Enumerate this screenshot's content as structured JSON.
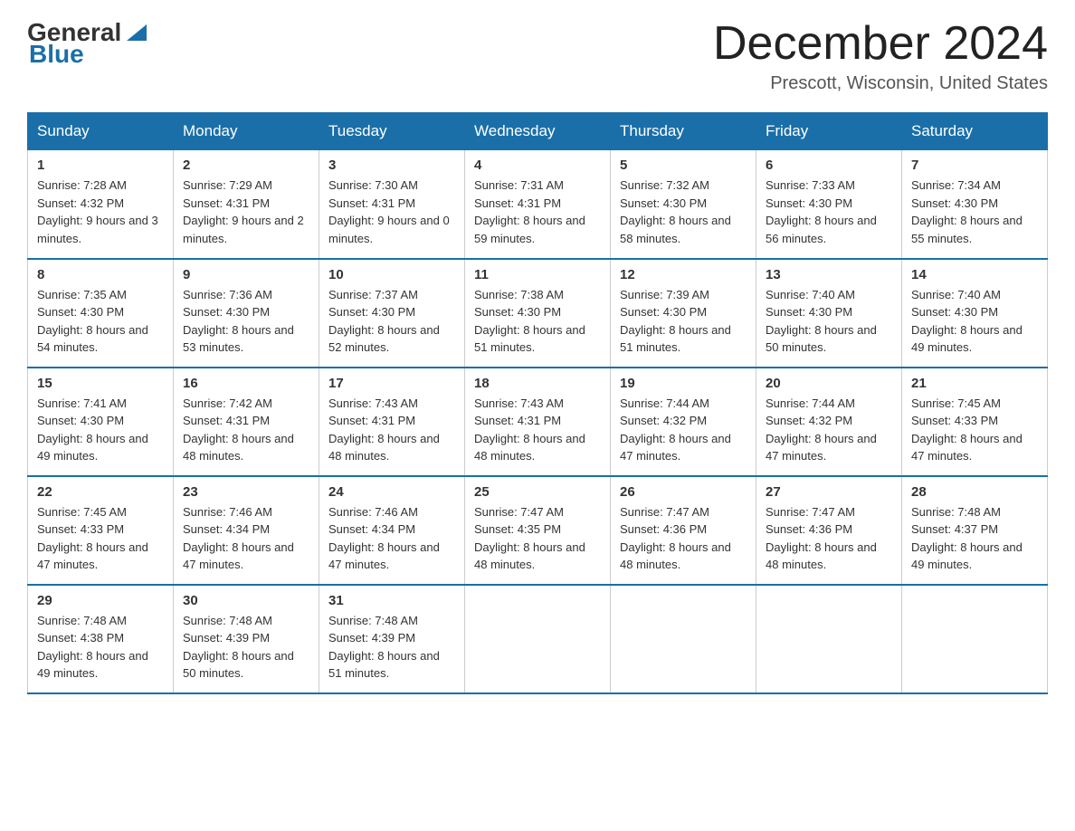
{
  "header": {
    "logo_general": "General",
    "logo_blue": "Blue",
    "month_title": "December 2024",
    "location": "Prescott, Wisconsin, United States"
  },
  "days_of_week": [
    "Sunday",
    "Monday",
    "Tuesday",
    "Wednesday",
    "Thursday",
    "Friday",
    "Saturday"
  ],
  "weeks": [
    [
      {
        "day": "1",
        "sunrise": "7:28 AM",
        "sunset": "4:32 PM",
        "daylight": "9 hours and 3 minutes."
      },
      {
        "day": "2",
        "sunrise": "7:29 AM",
        "sunset": "4:31 PM",
        "daylight": "9 hours and 2 minutes."
      },
      {
        "day": "3",
        "sunrise": "7:30 AM",
        "sunset": "4:31 PM",
        "daylight": "9 hours and 0 minutes."
      },
      {
        "day": "4",
        "sunrise": "7:31 AM",
        "sunset": "4:31 PM",
        "daylight": "8 hours and 59 minutes."
      },
      {
        "day": "5",
        "sunrise": "7:32 AM",
        "sunset": "4:30 PM",
        "daylight": "8 hours and 58 minutes."
      },
      {
        "day": "6",
        "sunrise": "7:33 AM",
        "sunset": "4:30 PM",
        "daylight": "8 hours and 56 minutes."
      },
      {
        "day": "7",
        "sunrise": "7:34 AM",
        "sunset": "4:30 PM",
        "daylight": "8 hours and 55 minutes."
      }
    ],
    [
      {
        "day": "8",
        "sunrise": "7:35 AM",
        "sunset": "4:30 PM",
        "daylight": "8 hours and 54 minutes."
      },
      {
        "day": "9",
        "sunrise": "7:36 AM",
        "sunset": "4:30 PM",
        "daylight": "8 hours and 53 minutes."
      },
      {
        "day": "10",
        "sunrise": "7:37 AM",
        "sunset": "4:30 PM",
        "daylight": "8 hours and 52 minutes."
      },
      {
        "day": "11",
        "sunrise": "7:38 AM",
        "sunset": "4:30 PM",
        "daylight": "8 hours and 51 minutes."
      },
      {
        "day": "12",
        "sunrise": "7:39 AM",
        "sunset": "4:30 PM",
        "daylight": "8 hours and 51 minutes."
      },
      {
        "day": "13",
        "sunrise": "7:40 AM",
        "sunset": "4:30 PM",
        "daylight": "8 hours and 50 minutes."
      },
      {
        "day": "14",
        "sunrise": "7:40 AM",
        "sunset": "4:30 PM",
        "daylight": "8 hours and 49 minutes."
      }
    ],
    [
      {
        "day": "15",
        "sunrise": "7:41 AM",
        "sunset": "4:30 PM",
        "daylight": "8 hours and 49 minutes."
      },
      {
        "day": "16",
        "sunrise": "7:42 AM",
        "sunset": "4:31 PM",
        "daylight": "8 hours and 48 minutes."
      },
      {
        "day": "17",
        "sunrise": "7:43 AM",
        "sunset": "4:31 PM",
        "daylight": "8 hours and 48 minutes."
      },
      {
        "day": "18",
        "sunrise": "7:43 AM",
        "sunset": "4:31 PM",
        "daylight": "8 hours and 48 minutes."
      },
      {
        "day": "19",
        "sunrise": "7:44 AM",
        "sunset": "4:32 PM",
        "daylight": "8 hours and 47 minutes."
      },
      {
        "day": "20",
        "sunrise": "7:44 AM",
        "sunset": "4:32 PM",
        "daylight": "8 hours and 47 minutes."
      },
      {
        "day": "21",
        "sunrise": "7:45 AM",
        "sunset": "4:33 PM",
        "daylight": "8 hours and 47 minutes."
      }
    ],
    [
      {
        "day": "22",
        "sunrise": "7:45 AM",
        "sunset": "4:33 PM",
        "daylight": "8 hours and 47 minutes."
      },
      {
        "day": "23",
        "sunrise": "7:46 AM",
        "sunset": "4:34 PM",
        "daylight": "8 hours and 47 minutes."
      },
      {
        "day": "24",
        "sunrise": "7:46 AM",
        "sunset": "4:34 PM",
        "daylight": "8 hours and 47 minutes."
      },
      {
        "day": "25",
        "sunrise": "7:47 AM",
        "sunset": "4:35 PM",
        "daylight": "8 hours and 48 minutes."
      },
      {
        "day": "26",
        "sunrise": "7:47 AM",
        "sunset": "4:36 PM",
        "daylight": "8 hours and 48 minutes."
      },
      {
        "day": "27",
        "sunrise": "7:47 AM",
        "sunset": "4:36 PM",
        "daylight": "8 hours and 48 minutes."
      },
      {
        "day": "28",
        "sunrise": "7:48 AM",
        "sunset": "4:37 PM",
        "daylight": "8 hours and 49 minutes."
      }
    ],
    [
      {
        "day": "29",
        "sunrise": "7:48 AM",
        "sunset": "4:38 PM",
        "daylight": "8 hours and 49 minutes."
      },
      {
        "day": "30",
        "sunrise": "7:48 AM",
        "sunset": "4:39 PM",
        "daylight": "8 hours and 50 minutes."
      },
      {
        "day": "31",
        "sunrise": "7:48 AM",
        "sunset": "4:39 PM",
        "daylight": "8 hours and 51 minutes."
      },
      null,
      null,
      null,
      null
    ]
  ]
}
